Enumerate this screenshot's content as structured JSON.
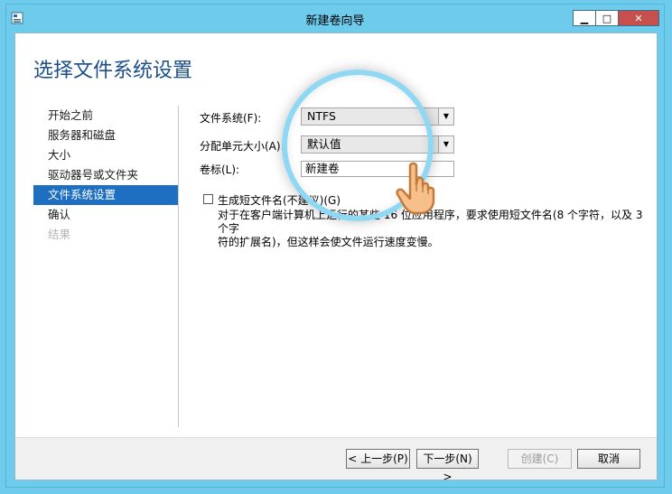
{
  "window": {
    "title": "新建卷向导",
    "minimize_glyph": "▁",
    "maximize_glyph": "□",
    "close_glyph": "✕"
  },
  "page": {
    "heading": "选择文件系统设置"
  },
  "nav": {
    "items": [
      {
        "label": "开始之前",
        "state": "normal"
      },
      {
        "label": "服务器和磁盘",
        "state": "normal"
      },
      {
        "label": "大小",
        "state": "normal"
      },
      {
        "label": "驱动器号或文件夹",
        "state": "normal"
      },
      {
        "label": "文件系统设置",
        "state": "active"
      },
      {
        "label": "确认",
        "state": "normal"
      },
      {
        "label": "结果",
        "state": "disabled"
      }
    ]
  },
  "form": {
    "filesystem_label": "文件系统(F):",
    "filesystem_value": "NTFS",
    "allocation_label": "分配单元大小(A):",
    "allocation_value": "默认值",
    "volume_label_label": "卷标(L):",
    "volume_label_value": "新建卷",
    "shortname_checkbox_label": "生成短文件名(不建议)(G)",
    "shortname_checked": false,
    "help_line1": "对于在客户端计算机上运行的某些 16 位应用程序，要求使用短文件名(8 个字符，以及 3 个字",
    "help_line2": "符的扩展名)，但这样会使文件运行速度变慢。"
  },
  "footer": {
    "prev_label": "< 上一步(P)",
    "next_label": "下一步(N) >",
    "create_label": "创建(C)",
    "cancel_label": "取消"
  },
  "colors": {
    "frame": "#6fcbec",
    "accent": "#1e6fc1",
    "heading": "#1b4f8a",
    "close": "#c7504f"
  },
  "icons": {
    "app": "volume-wizard-icon",
    "dropdown": "chevron-down-icon",
    "hand": "pointing-hand-icon"
  }
}
